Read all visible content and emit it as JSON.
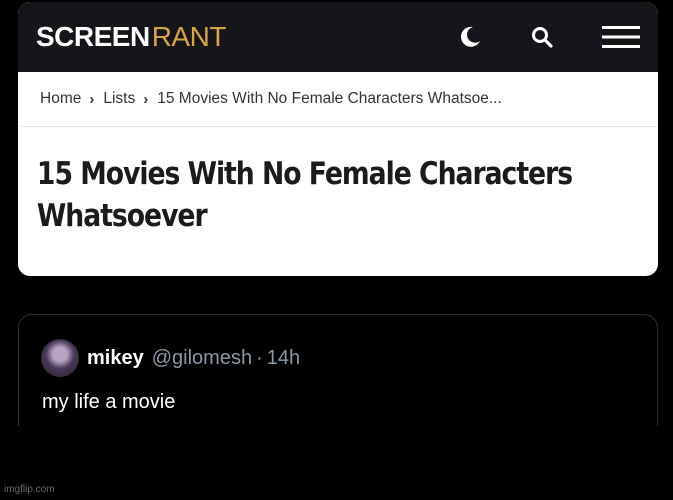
{
  "header": {
    "logo_part1": "SCREEN",
    "logo_part2": "RANT",
    "icons": [
      "moon-icon",
      "search-icon",
      "menu-icon"
    ],
    "colors": {
      "bar": "#16161a",
      "accent": "#d7a542"
    }
  },
  "breadcrumb": {
    "items": [
      "Home",
      "Lists",
      "15 Movies With No Female Characters Whatsoe..."
    ],
    "separator": "›"
  },
  "article": {
    "title_line1": "15 Movies With No Female Characters",
    "title_line2": "Whatsoever"
  },
  "tweet": {
    "name": "mikey",
    "handle": "@gilomesh",
    "separator": "·",
    "time": "14h",
    "text": "my life a movie"
  },
  "watermark": "imgflip.com"
}
